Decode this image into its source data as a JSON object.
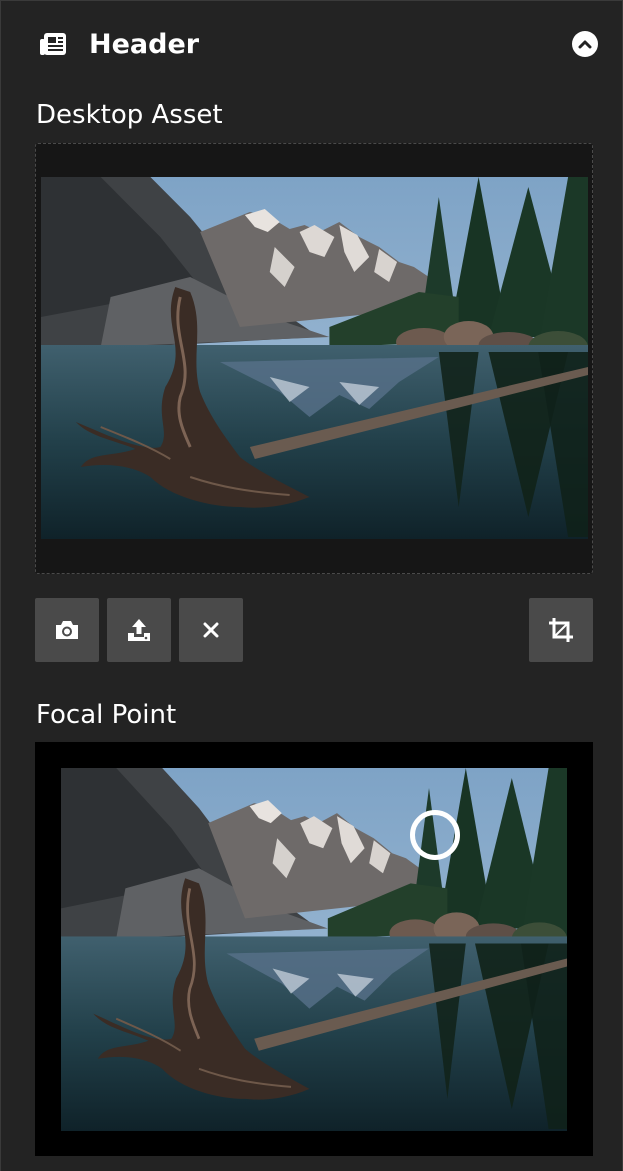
{
  "panel": {
    "title": "Header",
    "header_icon": "newspaper-icon",
    "collapse_icon": "chevron-up-icon"
  },
  "desktop_asset": {
    "label": "Desktop Asset",
    "image_subject": "mountain lake with driftwood"
  },
  "toolbar": {
    "buttons": [
      {
        "icon": "camera-icon"
      },
      {
        "icon": "upload-icon"
      },
      {
        "icon": "close-icon"
      },
      {
        "icon": "crop-icon"
      }
    ]
  },
  "focal_point": {
    "label": "Focal Point",
    "marker_icon": "focal-point-marker"
  },
  "colors": {
    "background": "#232323",
    "button": "#4a4a4a",
    "drop_zone": "#161616",
    "text": "#ffffff"
  }
}
